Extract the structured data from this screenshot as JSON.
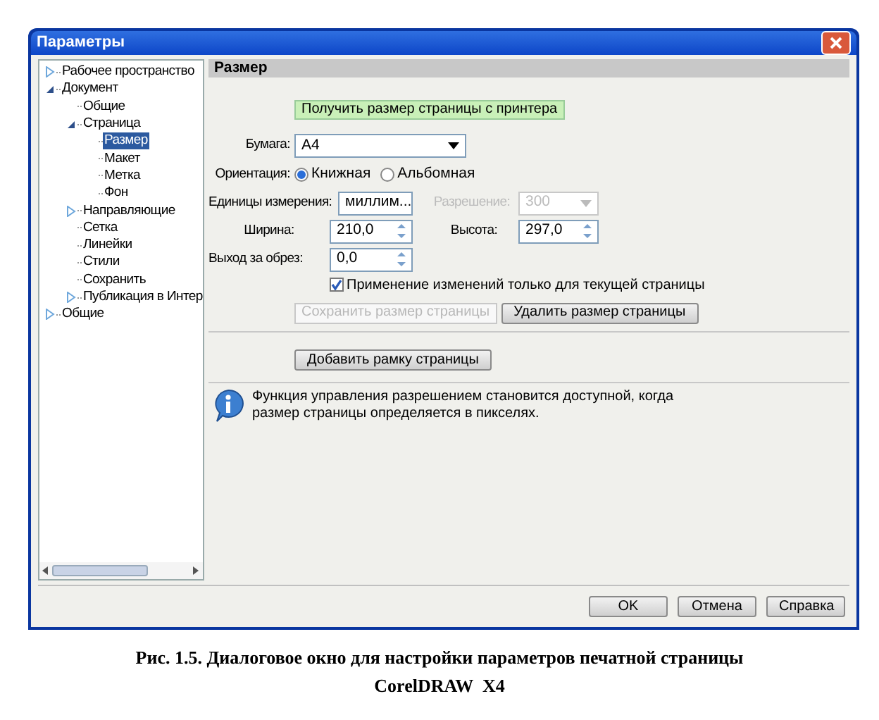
{
  "window": {
    "title": "Параметры"
  },
  "tree": [
    {
      "label": "Рабочее пространство",
      "expanded": false,
      "selected": false
    },
    {
      "label": "Документ",
      "expanded": true,
      "selected": false,
      "children": [
        {
          "label": "Общие",
          "selected": false
        },
        {
          "label": "Страница",
          "expanded": true,
          "selected": false,
          "children": [
            {
              "label": "Размер",
              "selected": true
            },
            {
              "label": "Макет",
              "selected": false
            },
            {
              "label": "Метка",
              "selected": false
            },
            {
              "label": "Фон",
              "selected": false
            }
          ]
        },
        {
          "label": "Направляющие",
          "expanded": false,
          "selected": false
        },
        {
          "label": "Сетка",
          "selected": false
        },
        {
          "label": "Линейки",
          "selected": false
        },
        {
          "label": "Стили",
          "selected": false
        },
        {
          "label": "Сохранить",
          "selected": false
        },
        {
          "label": "Публикация в Интер",
          "expanded": false,
          "selected": false
        }
      ]
    },
    {
      "label": "Общие",
      "expanded": false,
      "selected": false
    }
  ],
  "panel": {
    "header": "Размер",
    "printer_button": "Получить размер страницы с принтера",
    "paper": {
      "label": "Бумага:",
      "value": "A4"
    },
    "orientation": {
      "label": "Ориентация:",
      "options": [
        {
          "label": "Книжная",
          "selected": true
        },
        {
          "label": "Альбомная",
          "selected": false
        }
      ]
    },
    "units": {
      "label": "Единицы измерения:",
      "value": "миллим..."
    },
    "resolution": {
      "label": "Разрешение:",
      "value": "300",
      "disabled": true
    },
    "width": {
      "label": "Ширина:",
      "value": "210,0"
    },
    "height": {
      "label": "Высота:",
      "value": "297,0"
    },
    "bleed": {
      "label": "Выход за обрез:",
      "value": "0,0"
    },
    "apply_current": {
      "label": "Применение изменений только для текущей страницы",
      "checked": true
    },
    "save_button": {
      "label": "Сохранить размер страницы",
      "disabled": true
    },
    "delete_button": {
      "label": "Удалить размер страницы",
      "disabled": false
    },
    "add_frame_button": "Добавить рамку страницы",
    "info": "Функция управления разрешением становится доступной, когда размер страницы определяется в пикселях."
  },
  "buttons": [
    "OK",
    "Отмена",
    "Справка"
  ],
  "caption": [
    "Рис. 1.5. Диалоговое окно для настройки параметров печатной страницы",
    "CorelDRAW  X4"
  ]
}
